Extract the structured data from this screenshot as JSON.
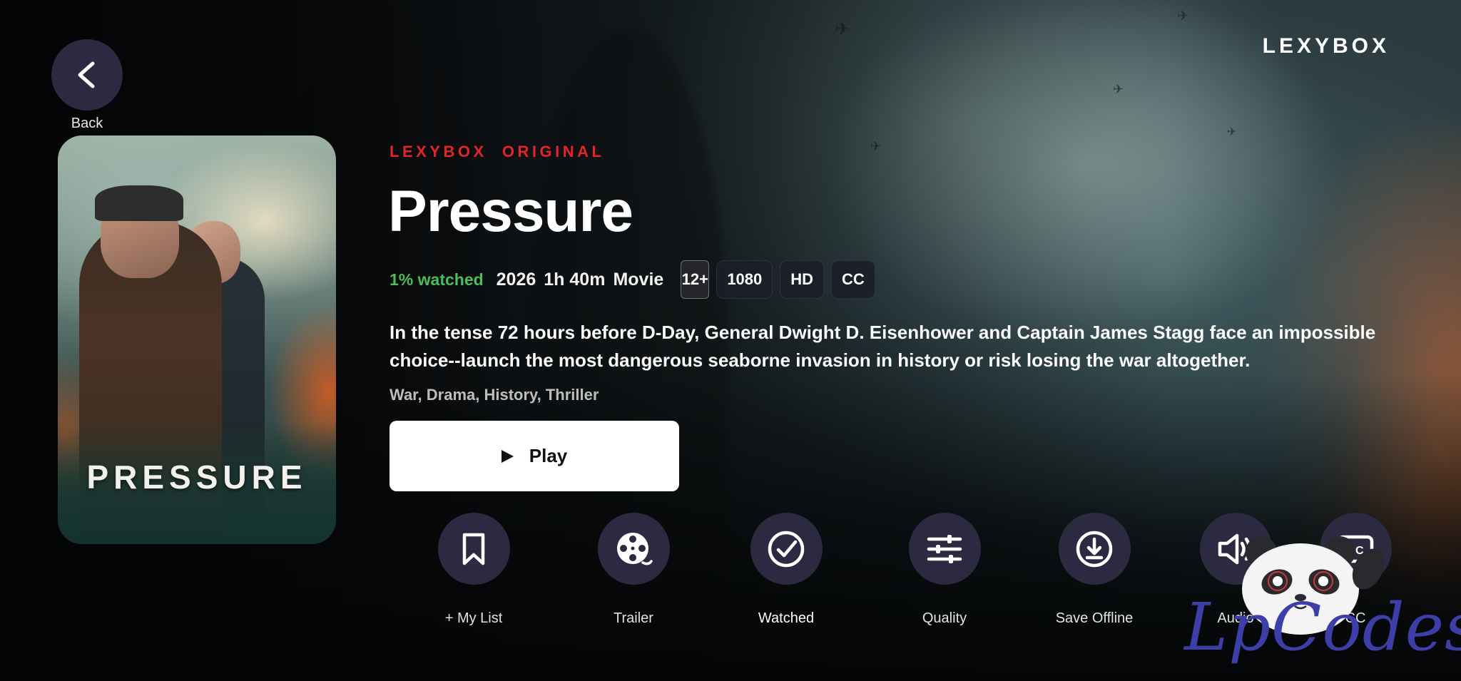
{
  "header": {
    "back_label": "Back",
    "brand": "LEXYBOX"
  },
  "poster": {
    "title_text": "PRESSURE"
  },
  "movie": {
    "original_tag": "LEXYBOX  ORIGINAL",
    "title": "Pressure",
    "progress_text": "1% watched",
    "progress_fraction": 0.01,
    "year": "2026",
    "duration": "1h 40m",
    "type": "Movie",
    "badges": [
      "12+",
      "1080",
      "HD",
      "CC"
    ],
    "description": "In the tense 72 hours before D-Day, General Dwight D. Eisenhower and Captain James Stagg face an impossible choice--launch the most dangerous seaborne invasion in history or risk losing the war altogether.",
    "genres": "War, Drama, History, Thriller"
  },
  "play": {
    "icon": "play-icon",
    "label": "Play"
  },
  "actions": [
    {
      "label": "+ My List",
      "icon": "bookmark-icon"
    },
    {
      "label": "Trailer",
      "icon": "film-reel-icon"
    },
    {
      "label": "Watched",
      "icon": "check-circle-icon"
    },
    {
      "label": "Quality",
      "icon": "sliders-icon"
    },
    {
      "label": "Save Offline",
      "icon": "download-icon"
    },
    {
      "label": "Audio",
      "icon": "speaker-icon"
    },
    {
      "label": "CC",
      "icon": "subtitles-icon"
    }
  ],
  "watermark": {
    "text": "LpCodes"
  },
  "colors": {
    "accent_red": "#e3242b",
    "progress_green": "#4cbd57",
    "button_circle": "#2b2a40",
    "play_button_bg": "#ffffff"
  }
}
